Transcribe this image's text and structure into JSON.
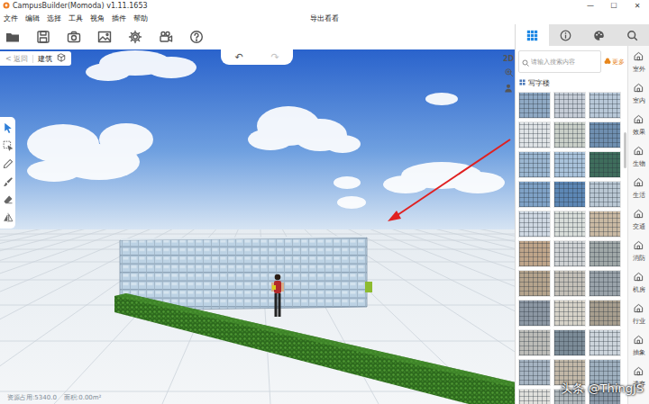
{
  "window": {
    "title": "CampusBuilder(Momoda) v1.11.1653",
    "controls": [
      "—",
      "☐",
      "✕"
    ]
  },
  "menu": [
    "文件",
    "编辑",
    "选择",
    "工具",
    "视角",
    "插件",
    "帮助"
  ],
  "project": "导出看看",
  "breadcrumb": {
    "back": "< 返回",
    "current": "建筑"
  },
  "undo_redo": [
    {
      "label": "↶",
      "disabled": false
    },
    {
      "label": "↷",
      "disabled": true
    }
  ],
  "view_mode": "2D",
  "tools": [
    {
      "kind": "pointer",
      "selected": true
    },
    {
      "kind": "select",
      "selected": false
    },
    {
      "kind": "pencil",
      "selected": false
    },
    {
      "kind": "brush",
      "selected": false
    },
    {
      "kind": "eraser",
      "selected": false
    },
    {
      "kind": "mirror",
      "selected": false
    }
  ],
  "panel": {
    "tabs": [
      {
        "kind": "grid",
        "selected": true
      },
      {
        "kind": "info",
        "selected": false
      },
      {
        "kind": "palette",
        "selected": false
      },
      {
        "kind": "search",
        "selected": false
      }
    ],
    "search": {
      "placeholder": "请输入搜索内容",
      "more": "更多"
    },
    "category": "写字楼",
    "thumbnails": [
      {
        "color": "#8fa9c4"
      },
      {
        "color": "#c5ccd6"
      },
      {
        "color": "#b8c8d8"
      },
      {
        "color": "#dfe3e6"
      },
      {
        "color": "#c9cfc8"
      },
      {
        "color": "#6f8fb0"
      },
      {
        "color": "#9bb6d0"
      },
      {
        "color": "#a9c2da"
      },
      {
        "color": "#3f6d5c"
      },
      {
        "color": "#7fa2c6"
      },
      {
        "color": "#5d87b5"
      },
      {
        "color": "#b9c7d3"
      },
      {
        "color": "#cfd8e2"
      },
      {
        "color": "#d8ddd9"
      },
      {
        "color": "#c9b9a3"
      },
      {
        "color": "#bfa58a"
      },
      {
        "color": "#cfd2d4"
      },
      {
        "color": "#a0a8a8"
      },
      {
        "color": "#b5a48d"
      },
      {
        "color": "#c4c0b8"
      },
      {
        "color": "#9aa3aa"
      },
      {
        "color": "#8c97a3"
      },
      {
        "color": "#d6d2c8"
      },
      {
        "color": "#a79e8e"
      },
      {
        "color": "#bcbcb8"
      },
      {
        "color": "#7c8c98"
      },
      {
        "color": "#cdd5dc"
      },
      {
        "color": "#a6b4c2"
      },
      {
        "color": "#c2b8a8"
      },
      {
        "color": "#9fb0bf"
      },
      {
        "color": "#e0e0dc"
      },
      {
        "color": "#b0b8bc"
      },
      {
        "color": "#8a99a8"
      }
    ]
  },
  "side_categories": [
    "室外",
    "室内",
    "效果",
    "生物",
    "生活",
    "交通",
    "消防",
    "机房",
    "行业",
    "抽象",
    "遗弃"
  ],
  "status_bar": {
    "resources": "资源占用:5340.0",
    "area": "面积:0.00m²"
  },
  "watermark": "头条 @ThingJS"
}
